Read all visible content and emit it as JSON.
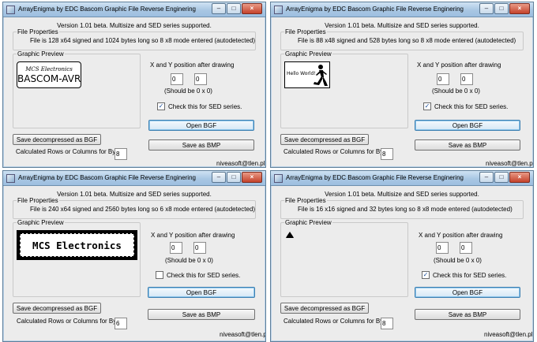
{
  "app_title": "ArrayEnigma by EDC  Bascom Graphic File Reverse Enginering",
  "version_text": "Version 1.01 beta. Multisize and SED series supported.",
  "labels": {
    "file_properties": "File Properties",
    "graphic_preview": "Graphic Preview",
    "xy_label": "X  and Y position after drawing",
    "should_be": "(Should be 0 x 0)",
    "sed_check": "Check this for SED series.",
    "open_bgf": "Open BGF",
    "save_decompressed": "Save decompressed as BGF",
    "save_bmp": "Save as BMP",
    "calc_label": "Calculated Rows or Columns for Byte",
    "email": "niveasoft@tlen.pl"
  },
  "window_controls": {
    "minimize": "–",
    "maximize": "□",
    "close": "×"
  },
  "windows": [
    {
      "file_info": "File is 128 x64 signed and 1024 bytes long so 8 x8 mode entered (autodetected)",
      "x_value": "0",
      "y_value": "0",
      "sed_checked": true,
      "calc_value": "8",
      "preview": {
        "type": "bascom",
        "line1": "MCS Electronics",
        "line2": "BASCOM-AVR"
      }
    },
    {
      "file_info": "File is 88 x48 signed and 528 bytes long so 8 x8 mode entered (autodetected)",
      "x_value": "0",
      "y_value": "0",
      "sed_checked": true,
      "calc_value": "8",
      "preview": {
        "type": "hello",
        "text": "Hello World!"
      }
    },
    {
      "file_info": "File is 240 x64 signed and 2560 bytes long so 6 x8 mode entered (autodetected)",
      "x_value": "0",
      "y_value": "0",
      "sed_checked": false,
      "calc_value": "6",
      "preview": {
        "type": "mcs",
        "text": "MCS Electronics"
      }
    },
    {
      "file_info": "File is 16 x16 signed and 32 bytes long so 8 x8 mode entered (autodetected)",
      "x_value": "0",
      "y_value": "0",
      "sed_checked": true,
      "calc_value": "8",
      "preview": {
        "type": "icon",
        "icon": "bell-shape-icon"
      }
    }
  ]
}
